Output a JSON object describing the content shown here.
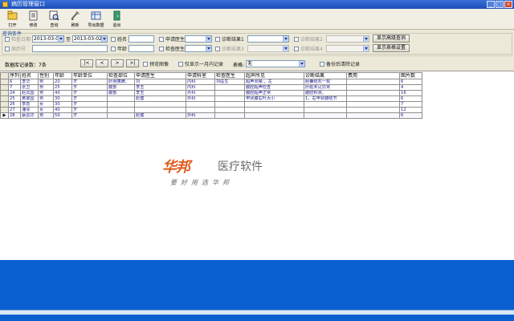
{
  "window": {
    "title": "病历管理窗口"
  },
  "toolbar": {
    "buttons": [
      {
        "label": "打开",
        "icon": "open-icon"
      },
      {
        "label": "修改",
        "icon": "edit-icon"
      },
      {
        "label": "查询",
        "icon": "search-icon"
      },
      {
        "label": "刷新",
        "icon": "refresh-icon"
      },
      {
        "label": "导出数据",
        "icon": "export-icon"
      },
      {
        "label": "退出",
        "icon": "exit-icon"
      }
    ]
  },
  "query": {
    "group_title": "查询条件",
    "date_label": "检查日期",
    "date_from": "2013-03-02",
    "date_to_label": "至",
    "date_to": "2013-03-02",
    "name_label": "姓名",
    "apply_doctor_label": "申请医生",
    "diag_result1_label": "诊断结果1",
    "diag_result2_label": "诊断结果2",
    "case_no_label": "病历号",
    "age_label": "年龄",
    "check_doctor_label": "检查医生",
    "diag_result3_label": "诊断结果3",
    "diag_result4_label": "诊断结果4",
    "show_advanced_btn": "显示高级查询",
    "show_table_btn": "显示表格设置"
  },
  "nav": {
    "record_count_label": "数据库记录数：",
    "record_count": "7条",
    "first_btn": "|<",
    "prev_btn": "<",
    "next_btn": ">",
    "last_btn": ">|",
    "preview_label": "预览图像",
    "show_one_month_label": "仅显示一月内记录",
    "table_label": "表格:",
    "table_value": "无",
    "clear_record_label": "备份后清除记录"
  },
  "table": {
    "columns": [
      "序列",
      "姓名",
      "性别",
      "年龄",
      "年龄单位",
      "检查部位",
      "申请医生",
      "申请科室",
      "检查医生",
      "超声所见",
      "诊断结果",
      "费用",
      "图片数"
    ],
    "rows": [
      [
        "6",
        "李华",
        "男",
        "20",
        "岁",
        "肝胆胰脾、",
        "刘",
        "内科",
        "刘医生",
        "超声测量:，左",
        "胆囊结石一枚",
        "",
        "6"
      ],
      [
        "7",
        "张卫",
        "男",
        "25",
        "岁",
        "腹部",
        "李玉",
        "内科",
        "",
        "腹腔超声检查",
        "肝脏未见异常",
        "",
        "4"
      ],
      [
        "24",
        "赵云国",
        "男",
        "40",
        "岁",
        "腹部",
        "李玉",
        "外科",
        "",
        "腹腔超声正常",
        "腹腔积液。",
        "",
        "16"
      ],
      [
        "25",
        "黄家国",
        "男",
        "30",
        "岁",
        "",
        "赵健",
        "外科",
        "",
        "甲状腺右叶大小",
        "1，右甲状腺结节",
        "",
        "6"
      ],
      [
        "26",
        "李蕊",
        "女",
        "30",
        "岁",
        "",
        "",
        "",
        "",
        "",
        "",
        "",
        "7"
      ],
      [
        "27",
        "潘琴",
        "女",
        "40",
        "岁",
        "",
        "",
        "",
        "",
        "",
        "",
        "",
        "12"
      ],
      [
        "28",
        "蔡云华",
        "男",
        "50",
        "岁",
        "",
        "赵健",
        "外科",
        "",
        "",
        "",
        "",
        "6"
      ]
    ],
    "selected_row": 6
  },
  "logo": {
    "brand": "华邦",
    "product": "医疗软件",
    "slogan": "要好用选华邦"
  },
  "colors": {
    "titlebar": "#1c4fb8",
    "bottom_panel": "#0a5fd0",
    "logo_orange": "#e05a1c"
  }
}
